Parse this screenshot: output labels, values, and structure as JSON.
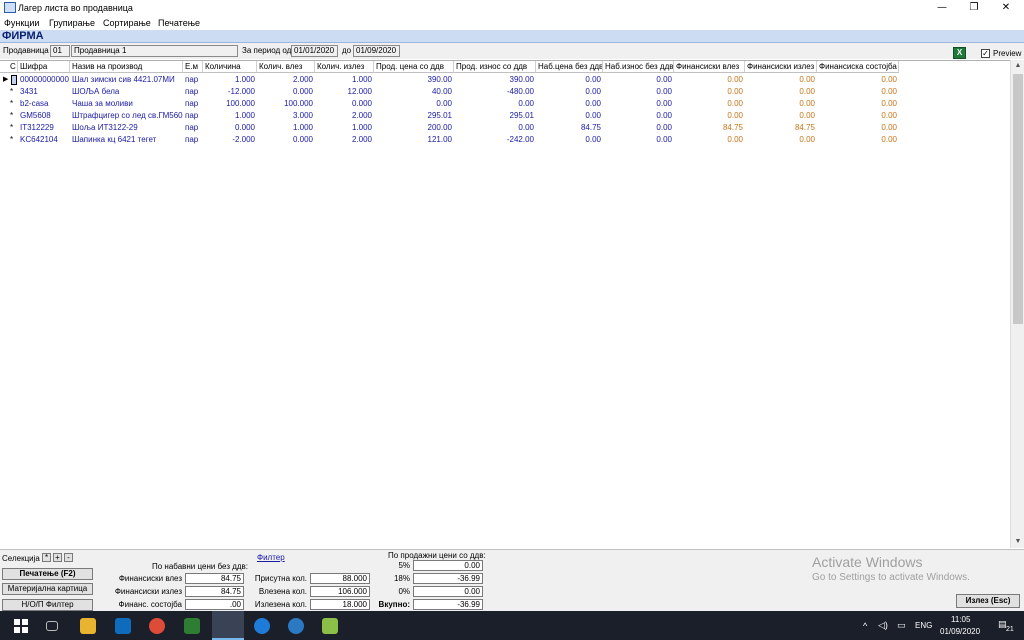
{
  "window": {
    "title": "Лагер листа во продавница"
  },
  "menu": [
    "Функции",
    "Групирање",
    "Сортирање",
    "Печатење"
  ],
  "company": "ФИРМА",
  "filter": {
    "store_label": "Продавница",
    "store_code": "01",
    "store_name": "Продавница 1",
    "period_label": "За период од",
    "date_from": "01/01/2020",
    "to_label": "до",
    "date_to": "01/09/2020",
    "preview_label": "Preview",
    "preview_checked": "✓"
  },
  "table": {
    "columns": [
      "С",
      "Шифра",
      "Назив на производ",
      "Е.м",
      "Количина",
      "Колич. влез",
      "Колич. излез",
      "Прод. цена со ддв",
      "Прод. износ со ддв",
      "Наб.цена без ддв",
      "Наб.износ без ддв",
      "Финансиски влез",
      "Финансиски излез",
      "Финансиска состојба"
    ],
    "rows": [
      [
        "",
        "00000000000",
        "Шал зимски сив 4421.07МИ",
        "пар",
        "1.000",
        "2.000",
        "1.000",
        "390.00",
        "390.00",
        "0.00",
        "0.00",
        "0.00",
        "0.00",
        "0.00"
      ],
      [
        "*",
        "3431",
        "ШОЉА бела",
        "пар",
        "-12.000",
        "0.000",
        "12.000",
        "40.00",
        "-480.00",
        "0.00",
        "0.00",
        "0.00",
        "0.00",
        "0.00"
      ],
      [
        "*",
        "b2-casa",
        "Чаша за моливи",
        "пар",
        "100.000",
        "100.000",
        "0.000",
        "0.00",
        "0.00",
        "0.00",
        "0.00",
        "0.00",
        "0.00",
        "0.00"
      ],
      [
        "*",
        "GM5608",
        "Штрафцигер со лед св.ГМ5608",
        "пар",
        "1.000",
        "3.000",
        "2.000",
        "295.01",
        "295.01",
        "0.00",
        "0.00",
        "0.00",
        "0.00",
        "0.00"
      ],
      [
        "*",
        "IT312229",
        "Шоља ИТ3122-29",
        "пар",
        "0.000",
        "1.000",
        "1.000",
        "200.00",
        "0.00",
        "84.75",
        "0.00",
        "84.75",
        "84.75",
        "0.00"
      ],
      [
        "*",
        "KC642104",
        "Шапинка кц 6421 тегет",
        "пар",
        "-2.000",
        "0.000",
        "2.000",
        "121.00",
        "-242.00",
        "0.00",
        "0.00",
        "0.00",
        "0.00",
        "0.00"
      ]
    ]
  },
  "bottom": {
    "selection_label": "Селекција",
    "sel_all": "*",
    "sel_plus": "+",
    "sel_minus": "-",
    "print_button": "Печатење (F2)",
    "material_card_button": "Материјална картица",
    "filter_button": "Н/О/П Филтер",
    "filter_link": "Филтер",
    "purchase_header": "По набавни цени без ддв:",
    "fin_in_label": "Финансиски влез",
    "fin_in_value": "84.75",
    "fin_out_label": "Финансиски излез",
    "fin_out_value": "84.75",
    "fin_state_label": "Финанс. состојба",
    "fin_state_value": ".00",
    "present_label": "Присутна кол.",
    "present_value": "88.000",
    "entered_label": "Влезена кол.",
    "entered_value": "106.000",
    "exited_label": "Излезена кол.",
    "exited_value": "18.000",
    "sales_header": "По продажни цени со ддв:",
    "vat5_label": "5%",
    "vat5_value": "0.00",
    "vat18_label": "18%",
    "vat18_value": "-36.99",
    "vat0_label": "0%",
    "vat0_value": "0.00",
    "total_label": "Вкупно:",
    "total_value": "-36.99",
    "exit_button": "Излез (Esc)",
    "watermark_title": "Activate Windows",
    "watermark_sub": "Go to Settings to activate Windows."
  },
  "taskbar": {
    "lang": "ENG",
    "time": "11:05",
    "date": "01/09/2020",
    "notifications": "21"
  }
}
